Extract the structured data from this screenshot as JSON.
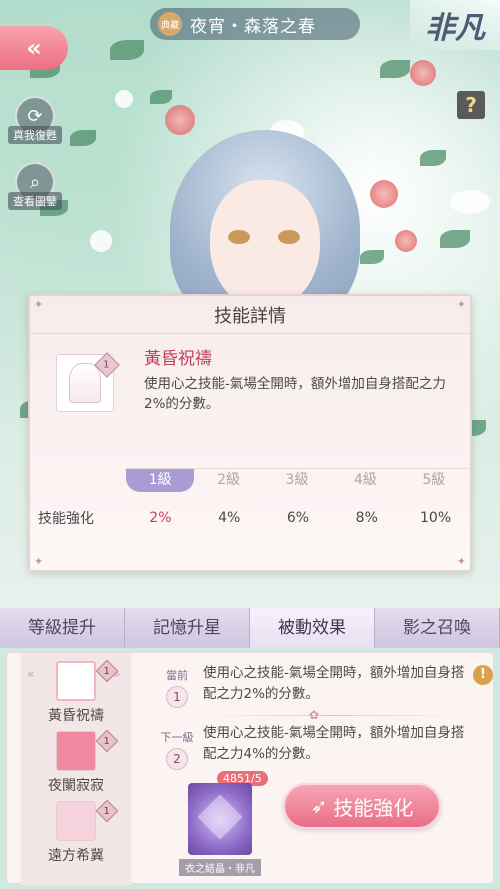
{
  "header": {
    "tag": "典藏",
    "title": "夜宵・森落之春",
    "rarity": "非凡",
    "help": "?"
  },
  "side_buttons": [
    {
      "label": "真我復甦"
    },
    {
      "label": "查看圖鑒"
    }
  ],
  "popup": {
    "title": "技能詳情",
    "skill_name": "黃昏祝禱",
    "skill_level": "1",
    "description": "使用心之技能-氣場全開時，額外增加自身搭配之力2%的分數。",
    "levels": [
      "1級",
      "2級",
      "3級",
      "4級",
      "5級"
    ],
    "row_label": "技能強化",
    "values": [
      "2%",
      "4%",
      "6%",
      "8%",
      "10%"
    ],
    "active_level": 0
  },
  "tabs": [
    "等級提升",
    "記憶升星",
    "被動效果",
    "影之召喚"
  ],
  "active_tab": 2,
  "skills": [
    {
      "name": "黃昏祝禱",
      "level": "1"
    },
    {
      "name": "夜闌寂寂",
      "level": "1"
    },
    {
      "name": "遠方希冀",
      "level": "1"
    }
  ],
  "effect": {
    "current_label": "當前",
    "current_num": "1",
    "current_text": "使用心之技能-氣場全開時，額外增加自身搭配之力2%的分數。",
    "next_label": "下一級",
    "next_num": "2",
    "next_text": "使用心之技能-氣場全開時，額外增加自身搭配之力4%的分數。"
  },
  "material": {
    "count": "4851/5",
    "name": "衣之結晶・非凡"
  },
  "enhance_button": "技能強化",
  "colors": {
    "accent_pink": "#ea6e87",
    "active_level": "#a99bd4",
    "skill_name": "#c33d5a"
  }
}
